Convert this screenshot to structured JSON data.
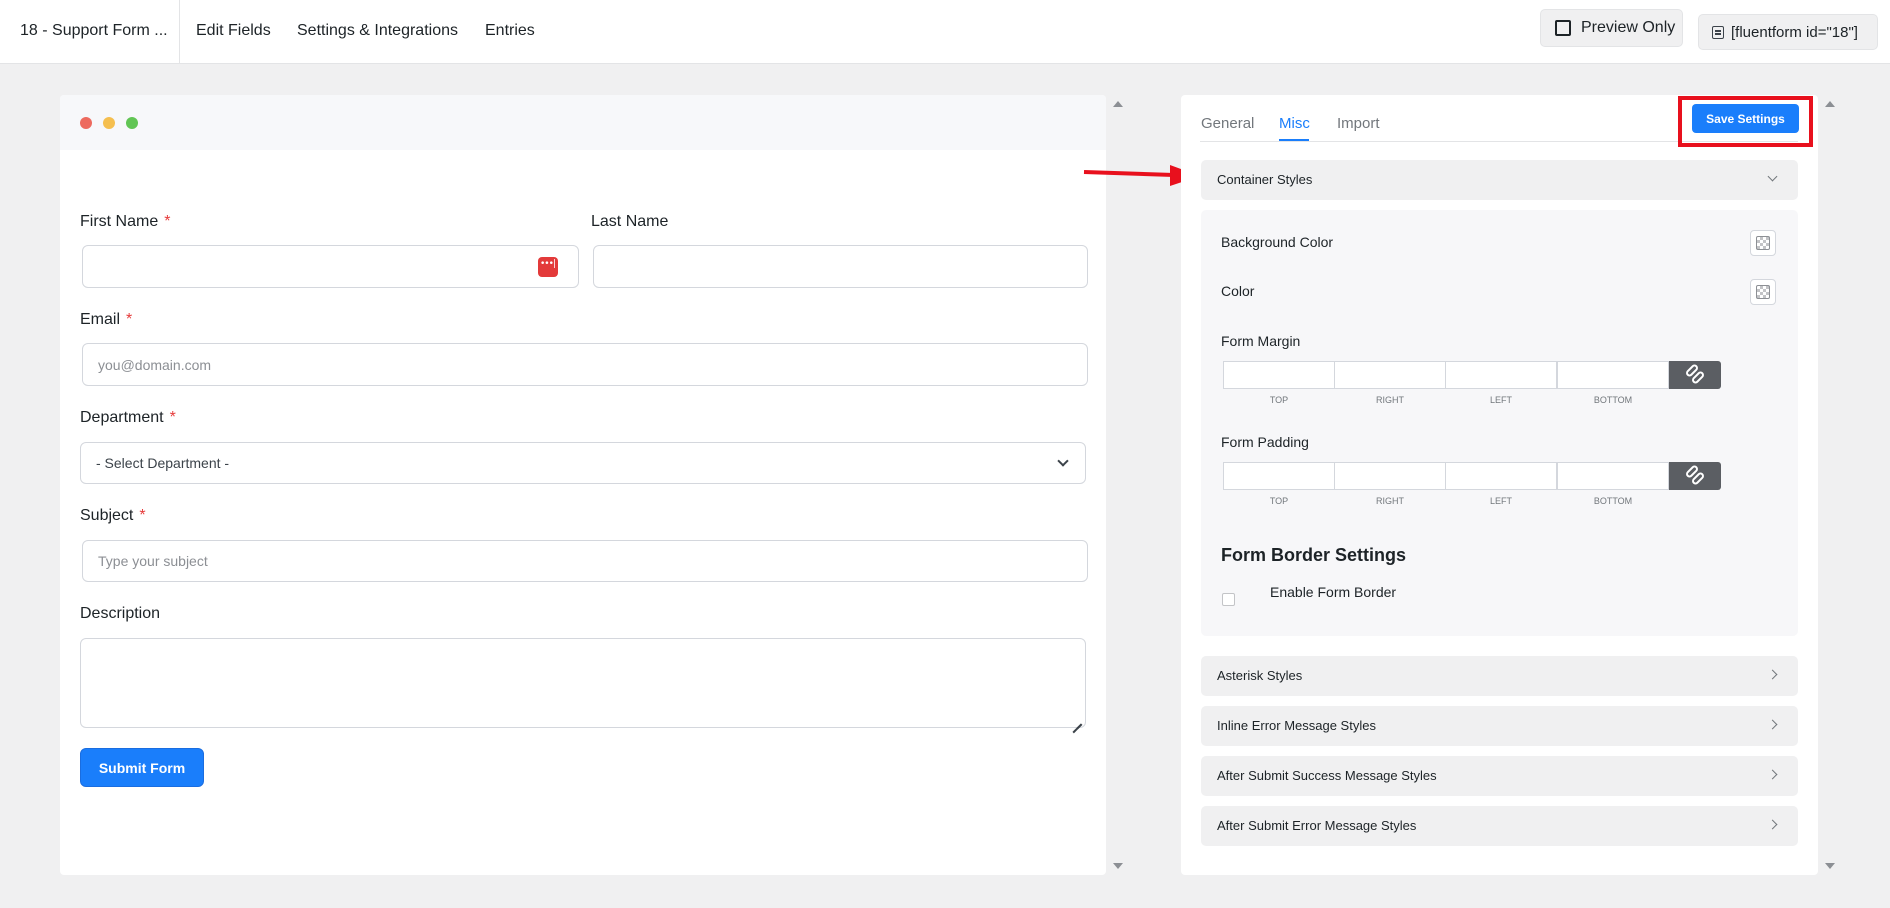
{
  "header": {
    "form_title": "18 - Support Form ...",
    "nav": [
      "Edit Fields",
      "Settings & Integrations",
      "Entries"
    ],
    "preview_label": "Preview Only",
    "shortcode": "[fluentform id=\"18\"]"
  },
  "form": {
    "first_name_label": "First Name",
    "last_name_label": "Last Name",
    "email_label": "Email",
    "email_placeholder": "you@domain.com",
    "department_label": "Department",
    "department_selected": "- Select Department -",
    "subject_label": "Subject",
    "subject_placeholder": "Type your subject",
    "description_label": "Description",
    "required_mark": "*",
    "submit_label": "Submit Form"
  },
  "settings": {
    "tabs": [
      "General",
      "Misc",
      "Import"
    ],
    "active_tab": "Misc",
    "save_label": "Save Settings",
    "container_styles": {
      "title": "Container Styles",
      "background_color_label": "Background Color",
      "color_label": "Color",
      "form_margin_label": "Form Margin",
      "form_padding_label": "Form Padding",
      "spacing_captions": [
        "TOP",
        "RIGHT",
        "LEFT",
        "BOTTOM"
      ],
      "border_settings_title": "Form Border Settings",
      "enable_border_label": "Enable Form Border"
    },
    "sections": [
      "Asterisk Styles",
      "Inline Error Message Styles",
      "After Submit Success Message Styles",
      "After Submit Error Message Styles"
    ]
  },
  "colors": {
    "accent": "#1a7efb",
    "annotation": "#e8101d",
    "dot_red": "#ed6a5e",
    "dot_yellow": "#f5bf4f",
    "dot_green": "#61c554"
  }
}
